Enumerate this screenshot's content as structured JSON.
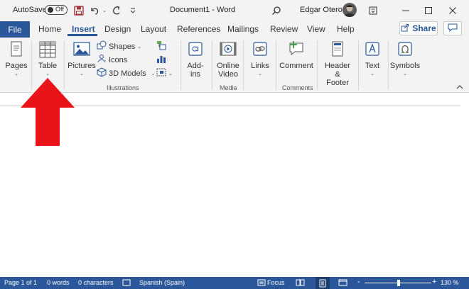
{
  "titlebar": {
    "autosave_label": "AutoSave",
    "autosave_state": "Off",
    "document_title": "Document1  -  Word",
    "user_name": "Edgar Otero",
    "icons": [
      "save-icon",
      "undo-icon",
      "redo-icon",
      "customize-qat-icon",
      "search-icon",
      "ribbon-display-icon",
      "minimize-icon",
      "maximize-icon",
      "close-icon"
    ]
  },
  "tabs": {
    "file": "File",
    "items": [
      "Home",
      "Insert",
      "Design",
      "Layout",
      "References",
      "Mailings",
      "Review",
      "View",
      "Help"
    ],
    "active": "Insert",
    "share_label": "Share"
  },
  "ribbon": {
    "pages": "Pages",
    "table": "Table",
    "pictures": "Pictures",
    "shapes": "Shapes",
    "icons": "Icons",
    "models": "3D Models",
    "illustrations_group": "Illustrations",
    "addins_1": "Add-",
    "addins_2": "ins",
    "online_video_1": "Online",
    "online_video_2": "Video",
    "media_group": "Media",
    "links": "Links",
    "comment": "Comment",
    "comments_group": "Comments",
    "header_footer_1": "Header &",
    "header_footer_2": "Footer",
    "text": "Text",
    "symbols": "Symbols"
  },
  "statusbar": {
    "page": "Page 1 of 1",
    "words": "0 words",
    "characters": "0 characters",
    "language": "Spanish (Spain)",
    "focus": "Focus",
    "zoom": "130 %",
    "zoom_minus": "-",
    "zoom_plus": "+"
  },
  "colors": {
    "accent": "#2b579a",
    "save_icon": "#a4373a",
    "arrow": "#e8141a"
  }
}
